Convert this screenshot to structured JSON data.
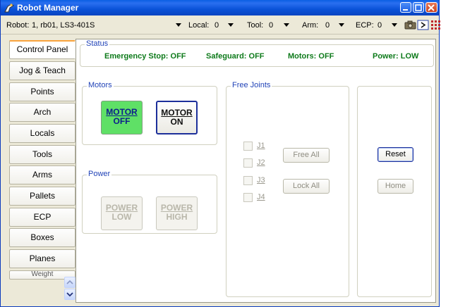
{
  "window": {
    "title": "Robot Manager",
    "icons": [
      "robot-icon",
      "minimize-icon",
      "maximize-icon",
      "close-icon"
    ]
  },
  "toolbar": {
    "robot_label": "Robot:",
    "robot_value": "1, rb01, LS3-401S",
    "local_label": "Local:",
    "local_value": "0",
    "tool_label": "Tool:",
    "tool_value": "0",
    "arm_label": "Arm:",
    "arm_value": "0",
    "ecp_label": "ECP:",
    "ecp_value": "0",
    "icons": [
      "camera-icon",
      "run-icon",
      "grid-icon"
    ]
  },
  "sidebar": {
    "tabs": [
      {
        "label": "Control Panel",
        "active": true
      },
      {
        "label": "Jog & Teach"
      },
      {
        "label": "Points"
      },
      {
        "label": "Arch"
      },
      {
        "label": "Locals"
      },
      {
        "label": "Tools"
      },
      {
        "label": "Arms"
      },
      {
        "label": "Pallets"
      },
      {
        "label": "ECP"
      },
      {
        "label": "Boxes"
      },
      {
        "label": "Planes"
      },
      {
        "label": "Weight"
      }
    ]
  },
  "status": {
    "title": "Status",
    "emergency_stop": "Emergency Stop: OFF",
    "safeguard": "Safeguard: OFF",
    "motors": "Motors: OFF",
    "power": "Power: LOW",
    "color": "#0d7a1a"
  },
  "motors": {
    "title": "Motors",
    "off_line1": "MOTOR",
    "off_line2": "OFF",
    "on_line1": "MOTOR",
    "on_line2": "ON"
  },
  "power": {
    "title": "Power",
    "low_line1": "POWER",
    "low_line2": "LOW",
    "high_line1": "POWER",
    "high_line2": "HIGH"
  },
  "free_joints": {
    "title": "Free Joints",
    "joints": [
      "J1",
      "J2",
      "J3",
      "J4"
    ],
    "free_all": "Free All",
    "lock_all": "Lock All"
  },
  "actions": {
    "reset": "Reset",
    "home": "Home"
  }
}
